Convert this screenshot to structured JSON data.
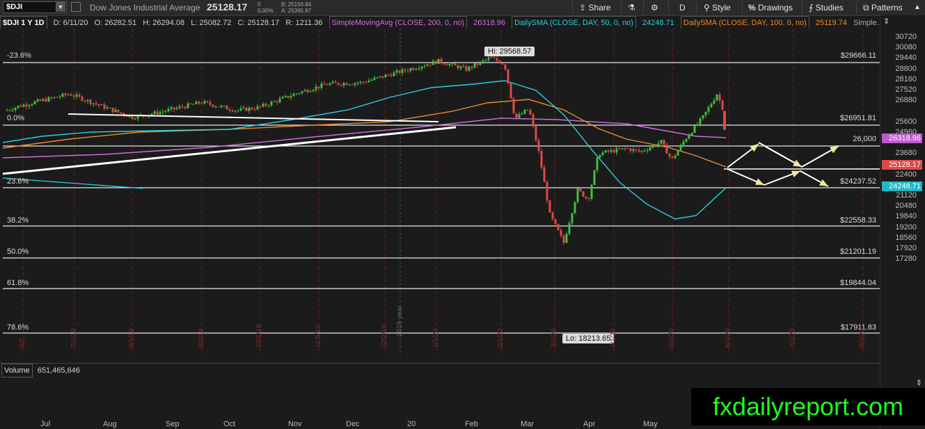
{
  "toolbar": {
    "symbol": "$DJI",
    "instrument_name": "Dow Jones Industrial Average",
    "last_price": "25128.17",
    "change_abs": "0",
    "change_pct": "0.00%",
    "bid": "B: 25156.84",
    "ask": "A: 25395.87",
    "share_label": "Share",
    "period_label": "D",
    "style_label": "Style",
    "drawings_label": "Drawings",
    "studies_label": "Studies",
    "patterns_label": "Patterns"
  },
  "studies": {
    "header": "$DJI 1 Y 1D",
    "date": "D: 6/11/20",
    "open": "O: 26282.51",
    "high": "H: 26294.08",
    "low": "L: 25082.72",
    "close": "C: 25128.17",
    "range": "R: 1211.36",
    "sma200_label": "SimpleMovingAvg (CLOSE, 200, 0, no)",
    "sma200_value": "26318.96",
    "sma50_label": "DailySMA (CLOSE, DAY, 50, 0, no)",
    "sma50_value": "24248.71",
    "sma100_label": "DailySMA (CLOSE, DAY, 100, 0, no)",
    "sma100_value": "25119.74",
    "more_label": "Simple..."
  },
  "colors": {
    "sma200": "#d36be0",
    "sma50": "#2ad1e0",
    "sma100": "#f08a2a",
    "up_candle": "#3fbf3f",
    "down_candle": "#e04848",
    "watermark": "#1dff1d"
  },
  "y_axis_ticks": [
    "30720",
    "30080",
    "29440",
    "28800",
    "28160",
    "27520",
    "26880",
    "25600",
    "24960",
    "23680",
    "23040",
    "22400",
    "21760",
    "21120",
    "20480",
    "19840",
    "19200",
    "18560",
    "17920",
    "17280"
  ],
  "axis_tags": {
    "sma200": "26318.96",
    "last": "25128.17",
    "sma50": "24248.71"
  },
  "fib_levels": [
    {
      "pct": "-23.6%",
      "price": "$29666.11"
    },
    {
      "pct": "0.0%",
      "price": "$26951.81"
    },
    {
      "pct": "",
      "price": "26,000"
    },
    {
      "pct": "23.6%",
      "price": "$24237.52"
    },
    {
      "pct": "38.2%",
      "price": "$22558.33"
    },
    {
      "pct": "50.0%",
      "price": "$21201.19"
    },
    {
      "pct": "61.8%",
      "price": "$19844.04"
    },
    {
      "pct": "78.6%",
      "price": "$17911.83"
    }
  ],
  "callouts": {
    "high": "Hi: 29568.57",
    "low": "Lo: 18213.65"
  },
  "vertical_date_labels": [
    "6/2",
    "7/1/19",
    "8/1/19",
    "9/2/19",
    "10/1/19",
    "11/5/19",
    "12/2/19",
    "1/1/20",
    "2/1/20",
    "3/2/20",
    "4/1/20",
    "5/1/20",
    "6/1/20",
    "7/1/20",
    "8/3/20"
  ],
  "year_marker": "2019 year",
  "volume": {
    "label": "Volume",
    "value": "651,465,646"
  },
  "months": [
    "Jul",
    "Aug",
    "Sep",
    "Oct",
    "Nov",
    "Dec",
    "20",
    "Feb",
    "Mar",
    "Apr",
    "May"
  ],
  "watermark": "fxdailyreport.com"
}
